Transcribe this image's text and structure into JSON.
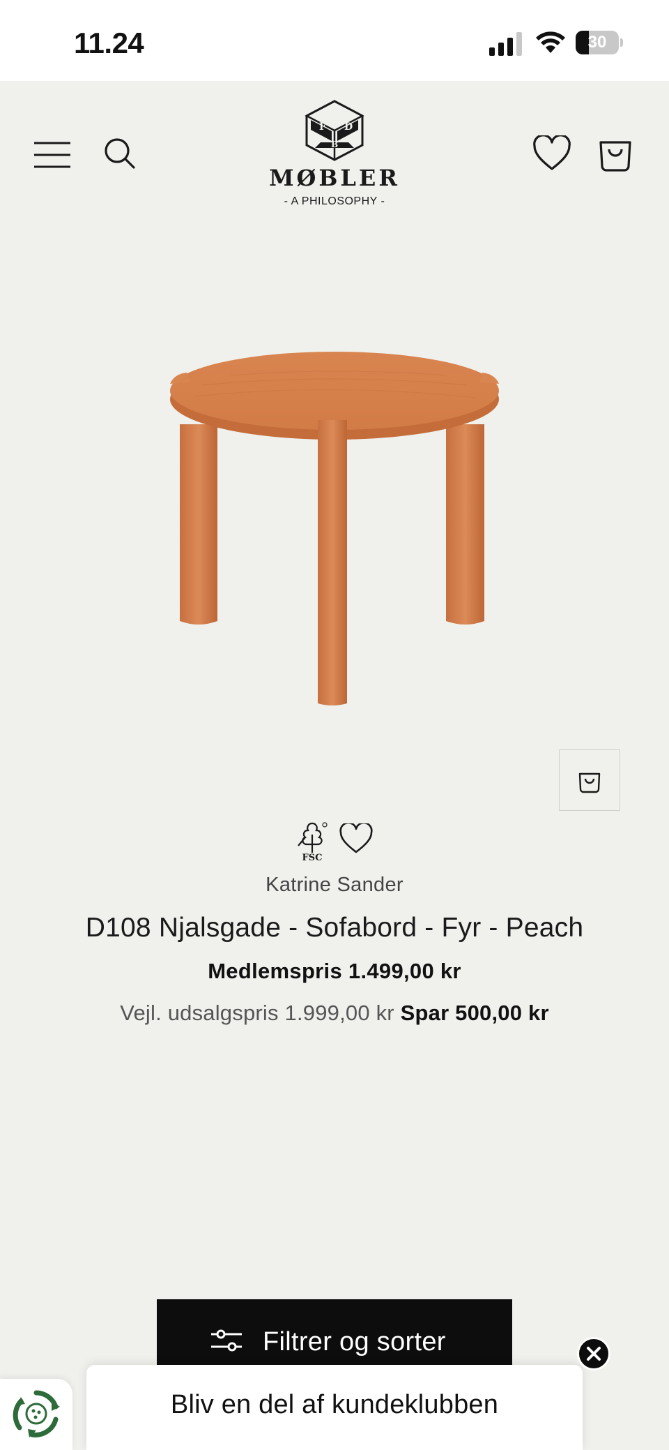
{
  "status_bar": {
    "time": "11.24",
    "battery_level": "30",
    "battery_fraction": 0.3
  },
  "header": {
    "brand_name": "MØBLER",
    "brand_tagline": "- A PHILOSOPHY -",
    "logo_letters": [
      "F",
      "D",
      "B"
    ],
    "icons": {
      "menu": "hamburger-menu-icon",
      "search": "search-icon",
      "wishlist": "heart-icon",
      "cart": "shopping-bag-icon"
    }
  },
  "product": {
    "image_subject": "round pine side table, peach finish, three legs",
    "certification": "FSC",
    "designer": "Katrine Sander",
    "title": "D108 Njalsgade - Sofabord - Fyr - Peach",
    "member_price": "Medlemspris 1.499,00 kr",
    "rrp": "Vejl. udsalgspris 1.999,00 kr",
    "saving": "Spar 500,00 kr"
  },
  "actions": {
    "filter_sort": "Filtrer og sorter"
  },
  "club_banner": {
    "text": "Bliv en del af kundeklubben"
  },
  "colors": {
    "page_bg": "#f0f0ec",
    "wood": "#d2804f",
    "button_bg": "#0d0d0d",
    "eco_green": "#2e6b3a"
  }
}
